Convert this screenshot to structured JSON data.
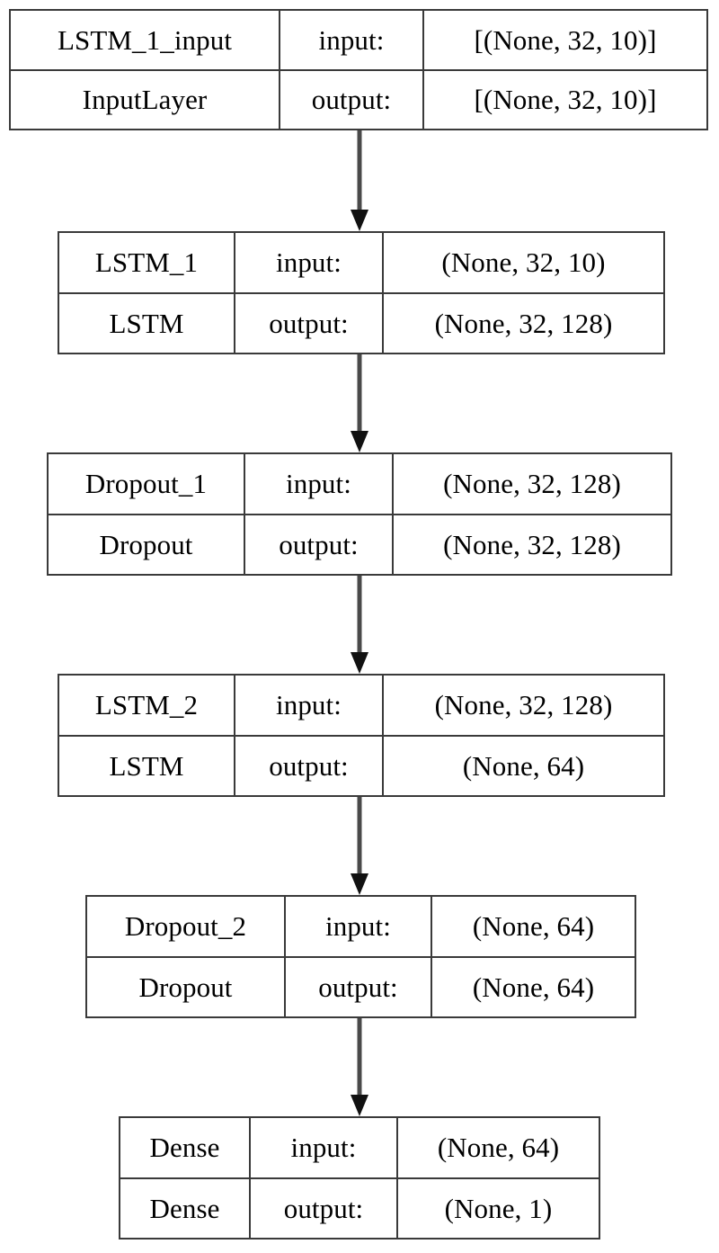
{
  "diagram": {
    "title": "Keras model architecture graph",
    "type": "keras-plot-model",
    "edge_color": "#4a4a4a",
    "border_color": "#3a3a3a",
    "background": "#ffffff",
    "nodes": [
      {
        "id": "LSTM_1_input",
        "name": "LSTM_1_input",
        "class": "InputLayer",
        "input_label": "input:",
        "output_label": "output:",
        "input_shape": "[(None, 32, 10)]",
        "output_shape": "[(None, 32, 10)]"
      },
      {
        "id": "LSTM_1",
        "name": "LSTM_1",
        "class": "LSTM",
        "input_label": "input:",
        "output_label": "output:",
        "input_shape": "(None, 32, 10)",
        "output_shape": "(None, 32, 128)"
      },
      {
        "id": "Dropout_1",
        "name": "Dropout_1",
        "class": "Dropout",
        "input_label": "input:",
        "output_label": "output:",
        "input_shape": "(None, 32, 128)",
        "output_shape": "(None, 32, 128)"
      },
      {
        "id": "LSTM_2",
        "name": "LSTM_2",
        "class": "LSTM",
        "input_label": "input:",
        "output_label": "output:",
        "input_shape": "(None, 32, 128)",
        "output_shape": "(None, 64)"
      },
      {
        "id": "Dropout_2",
        "name": "Dropout_2",
        "class": "Dropout",
        "input_label": "input:",
        "output_label": "output:",
        "input_shape": "(None, 64)",
        "output_shape": "(None, 64)"
      },
      {
        "id": "Dense",
        "name": "Dense",
        "class": "Dense",
        "input_label": "input:",
        "output_label": "output:",
        "input_shape": "(None, 64)",
        "output_shape": "(None, 1)"
      }
    ],
    "edges": [
      {
        "from": "LSTM_1_input",
        "to": "LSTM_1"
      },
      {
        "from": "LSTM_1",
        "to": "Dropout_1"
      },
      {
        "from": "Dropout_1",
        "to": "LSTM_2"
      },
      {
        "from": "LSTM_2",
        "to": "Dropout_2"
      },
      {
        "from": "Dropout_2",
        "to": "Dense"
      }
    ]
  }
}
